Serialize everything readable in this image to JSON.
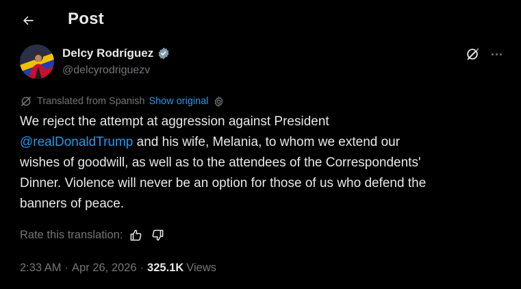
{
  "header": {
    "back_icon": "arrow-left-icon",
    "title": "Post"
  },
  "author": {
    "name": "Delcy Rodríguez",
    "handle": "@delcyrodriguezv",
    "verified_icon": "verified-badge-icon",
    "avatar_icon": "avatar-image"
  },
  "actions": {
    "grok_icon": "grok-icon",
    "more_icon": "more-dots-icon"
  },
  "translation": {
    "icon": "translate-icon",
    "label": "Translated from Spanish",
    "show_original": "Show original",
    "settings_icon": "gear-icon"
  },
  "post": {
    "line1": "We reject the attempt at aggression against President",
    "mention": "@realDonaldTrump",
    "line2_rest": " and his wife, Melania, to whom we extend our",
    "line3": "wishes of goodwill, as well as to the attendees of the Correspondents'",
    "line4": "Dinner. Violence will never be an option for those of us who defend the",
    "line5": "banners of peace."
  },
  "rate": {
    "label": "Rate this translation:",
    "thumbs_up_icon": "thumbs-up-icon",
    "thumbs_down_icon": "thumbs-down-icon"
  },
  "meta": {
    "time": "2:33 AM",
    "separator": "·",
    "date": "Apr 26, 2026",
    "views_count": "325.1K",
    "views_label": "Views"
  },
  "colors": {
    "background": "#000000",
    "text": "#e7e9ea",
    "secondary": "#71767b",
    "accent": "#1d9bf0"
  }
}
